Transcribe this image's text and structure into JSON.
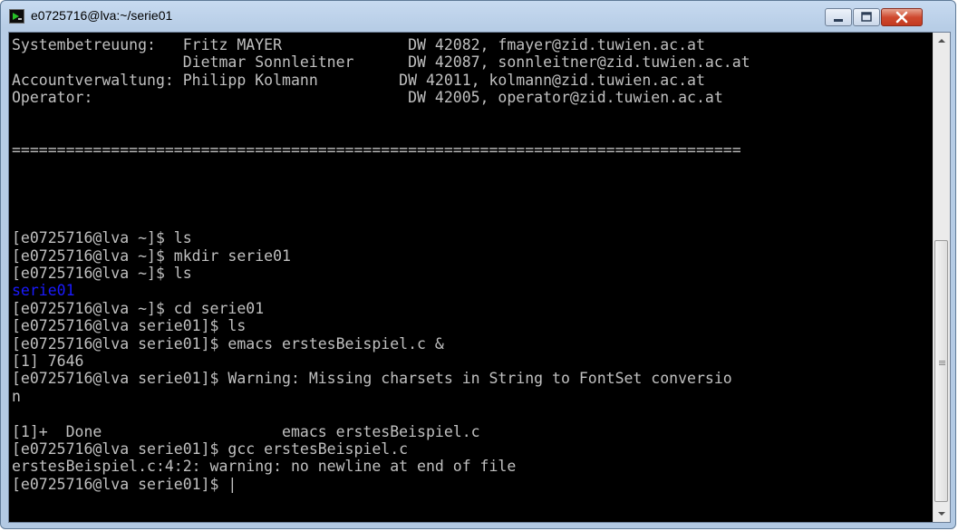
{
  "window": {
    "title": "e0725716@lva:~/serie01"
  },
  "terminal": {
    "lines": [
      {
        "text": "Systembetreuung:   Fritz MAYER              DW 42082, fmayer@zid.tuwien.ac.at"
      },
      {
        "text": "                   Dietmar Sonnleitner      DW 42087, sonnleitner@zid.tuwien.ac.at"
      },
      {
        "text": "Accountverwaltung: Philipp Kolmann         DW 42011, kolmann@zid.tuwien.ac.at"
      },
      {
        "text": "Operator:                                   DW 42005, operator@zid.tuwien.ac.at"
      },
      {
        "text": ""
      },
      {
        "text": ""
      },
      {
        "text": "================================================================================="
      },
      {
        "text": ""
      },
      {
        "text": ""
      },
      {
        "text": ""
      },
      {
        "text": ""
      },
      {
        "text": "[e0725716@lva ~]$ ls"
      },
      {
        "text": "[e0725716@lva ~]$ mkdir serie01"
      },
      {
        "text": "[e0725716@lva ~]$ ls"
      },
      {
        "text": "serie01",
        "kind": "dir"
      },
      {
        "text": "[e0725716@lva ~]$ cd serie01"
      },
      {
        "text": "[e0725716@lva serie01]$ ls"
      },
      {
        "text": "[e0725716@lva serie01]$ emacs erstesBeispiel.c &"
      },
      {
        "text": "[1] 7646"
      },
      {
        "text": "[e0725716@lva serie01]$ Warning: Missing charsets in String to FontSet conversio"
      },
      {
        "text": "n"
      },
      {
        "text": ""
      },
      {
        "text": "[1]+  Done                    emacs erstesBeispiel.c"
      },
      {
        "text": "[e0725716@lva serie01]$ gcc erstesBeispiel.c"
      },
      {
        "text": "erstesBeispiel.c:4:2: warning: no newline at end of file"
      },
      {
        "text": "[e0725716@lva serie01]$ ",
        "cursor": "|"
      }
    ]
  },
  "scrollbar": {
    "position_fraction": 1.0,
    "visible_fraction": 0.55
  },
  "colors": {
    "terminal_bg": "#000000",
    "terminal_fg": "#c0c0c0",
    "directory": "#1a1aff"
  },
  "icons": {
    "app": "putty-terminal-icon",
    "minimize": "minimize-icon",
    "maximize": "maximize-icon",
    "close": "close-icon",
    "scroll_up": "arrow-up-icon",
    "scroll_down": "arrow-down-icon"
  }
}
